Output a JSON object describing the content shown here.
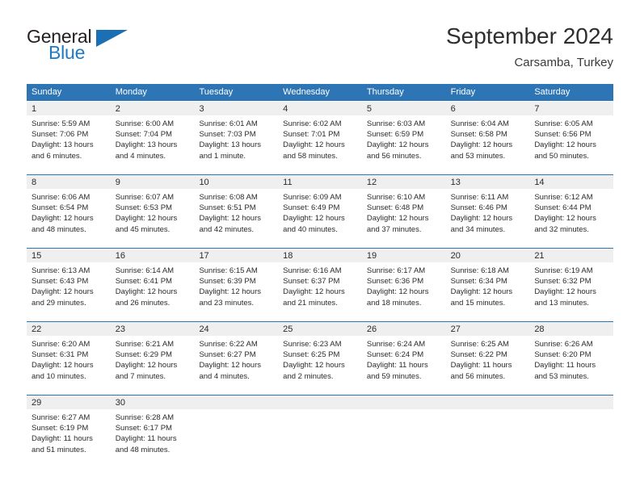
{
  "brand": {
    "name_part1": "General",
    "name_part2": "Blue",
    "flag_icon": "brand-triangle-icon"
  },
  "header": {
    "title": "September 2024",
    "subtitle": "Carsamba, Turkey"
  },
  "colors": {
    "header_blue": "#2e75b6",
    "brand_blue": "#1f7ac4",
    "day_band_gray": "#efefef",
    "text_dark": "#2b2b2b"
  },
  "weekdays": [
    "Sunday",
    "Monday",
    "Tuesday",
    "Wednesday",
    "Thursday",
    "Friday",
    "Saturday"
  ],
  "weeks": [
    {
      "separator": false,
      "days": [
        {
          "num": "1",
          "sunrise": "Sunrise: 5:59 AM",
          "sunset": "Sunset: 7:06 PM",
          "daylight_line1": "Daylight: 13 hours",
          "daylight_line2": "and 6 minutes."
        },
        {
          "num": "2",
          "sunrise": "Sunrise: 6:00 AM",
          "sunset": "Sunset: 7:04 PM",
          "daylight_line1": "Daylight: 13 hours",
          "daylight_line2": "and 4 minutes."
        },
        {
          "num": "3",
          "sunrise": "Sunrise: 6:01 AM",
          "sunset": "Sunset: 7:03 PM",
          "daylight_line1": "Daylight: 13 hours",
          "daylight_line2": "and 1 minute."
        },
        {
          "num": "4",
          "sunrise": "Sunrise: 6:02 AM",
          "sunset": "Sunset: 7:01 PM",
          "daylight_line1": "Daylight: 12 hours",
          "daylight_line2": "and 58 minutes."
        },
        {
          "num": "5",
          "sunrise": "Sunrise: 6:03 AM",
          "sunset": "Sunset: 6:59 PM",
          "daylight_line1": "Daylight: 12 hours",
          "daylight_line2": "and 56 minutes."
        },
        {
          "num": "6",
          "sunrise": "Sunrise: 6:04 AM",
          "sunset": "Sunset: 6:58 PM",
          "daylight_line1": "Daylight: 12 hours",
          "daylight_line2": "and 53 minutes."
        },
        {
          "num": "7",
          "sunrise": "Sunrise: 6:05 AM",
          "sunset": "Sunset: 6:56 PM",
          "daylight_line1": "Daylight: 12 hours",
          "daylight_line2": "and 50 minutes."
        }
      ]
    },
    {
      "separator": true,
      "days": [
        {
          "num": "8",
          "sunrise": "Sunrise: 6:06 AM",
          "sunset": "Sunset: 6:54 PM",
          "daylight_line1": "Daylight: 12 hours",
          "daylight_line2": "and 48 minutes."
        },
        {
          "num": "9",
          "sunrise": "Sunrise: 6:07 AM",
          "sunset": "Sunset: 6:53 PM",
          "daylight_line1": "Daylight: 12 hours",
          "daylight_line2": "and 45 minutes."
        },
        {
          "num": "10",
          "sunrise": "Sunrise: 6:08 AM",
          "sunset": "Sunset: 6:51 PM",
          "daylight_line1": "Daylight: 12 hours",
          "daylight_line2": "and 42 minutes."
        },
        {
          "num": "11",
          "sunrise": "Sunrise: 6:09 AM",
          "sunset": "Sunset: 6:49 PM",
          "daylight_line1": "Daylight: 12 hours",
          "daylight_line2": "and 40 minutes."
        },
        {
          "num": "12",
          "sunrise": "Sunrise: 6:10 AM",
          "sunset": "Sunset: 6:48 PM",
          "daylight_line1": "Daylight: 12 hours",
          "daylight_line2": "and 37 minutes."
        },
        {
          "num": "13",
          "sunrise": "Sunrise: 6:11 AM",
          "sunset": "Sunset: 6:46 PM",
          "daylight_line1": "Daylight: 12 hours",
          "daylight_line2": "and 34 minutes."
        },
        {
          "num": "14",
          "sunrise": "Sunrise: 6:12 AM",
          "sunset": "Sunset: 6:44 PM",
          "daylight_line1": "Daylight: 12 hours",
          "daylight_line2": "and 32 minutes."
        }
      ]
    },
    {
      "separator": true,
      "days": [
        {
          "num": "15",
          "sunrise": "Sunrise: 6:13 AM",
          "sunset": "Sunset: 6:43 PM",
          "daylight_line1": "Daylight: 12 hours",
          "daylight_line2": "and 29 minutes."
        },
        {
          "num": "16",
          "sunrise": "Sunrise: 6:14 AM",
          "sunset": "Sunset: 6:41 PM",
          "daylight_line1": "Daylight: 12 hours",
          "daylight_line2": "and 26 minutes."
        },
        {
          "num": "17",
          "sunrise": "Sunrise: 6:15 AM",
          "sunset": "Sunset: 6:39 PM",
          "daylight_line1": "Daylight: 12 hours",
          "daylight_line2": "and 23 minutes."
        },
        {
          "num": "18",
          "sunrise": "Sunrise: 6:16 AM",
          "sunset": "Sunset: 6:37 PM",
          "daylight_line1": "Daylight: 12 hours",
          "daylight_line2": "and 21 minutes."
        },
        {
          "num": "19",
          "sunrise": "Sunrise: 6:17 AM",
          "sunset": "Sunset: 6:36 PM",
          "daylight_line1": "Daylight: 12 hours",
          "daylight_line2": "and 18 minutes."
        },
        {
          "num": "20",
          "sunrise": "Sunrise: 6:18 AM",
          "sunset": "Sunset: 6:34 PM",
          "daylight_line1": "Daylight: 12 hours",
          "daylight_line2": "and 15 minutes."
        },
        {
          "num": "21",
          "sunrise": "Sunrise: 6:19 AM",
          "sunset": "Sunset: 6:32 PM",
          "daylight_line1": "Daylight: 12 hours",
          "daylight_line2": "and 13 minutes."
        }
      ]
    },
    {
      "separator": true,
      "days": [
        {
          "num": "22",
          "sunrise": "Sunrise: 6:20 AM",
          "sunset": "Sunset: 6:31 PM",
          "daylight_line1": "Daylight: 12 hours",
          "daylight_line2": "and 10 minutes."
        },
        {
          "num": "23",
          "sunrise": "Sunrise: 6:21 AM",
          "sunset": "Sunset: 6:29 PM",
          "daylight_line1": "Daylight: 12 hours",
          "daylight_line2": "and 7 minutes."
        },
        {
          "num": "24",
          "sunrise": "Sunrise: 6:22 AM",
          "sunset": "Sunset: 6:27 PM",
          "daylight_line1": "Daylight: 12 hours",
          "daylight_line2": "and 4 minutes."
        },
        {
          "num": "25",
          "sunrise": "Sunrise: 6:23 AM",
          "sunset": "Sunset: 6:25 PM",
          "daylight_line1": "Daylight: 12 hours",
          "daylight_line2": "and 2 minutes."
        },
        {
          "num": "26",
          "sunrise": "Sunrise: 6:24 AM",
          "sunset": "Sunset: 6:24 PM",
          "daylight_line1": "Daylight: 11 hours",
          "daylight_line2": "and 59 minutes."
        },
        {
          "num": "27",
          "sunrise": "Sunrise: 6:25 AM",
          "sunset": "Sunset: 6:22 PM",
          "daylight_line1": "Daylight: 11 hours",
          "daylight_line2": "and 56 minutes."
        },
        {
          "num": "28",
          "sunrise": "Sunrise: 6:26 AM",
          "sunset": "Sunset: 6:20 PM",
          "daylight_line1": "Daylight: 11 hours",
          "daylight_line2": "and 53 minutes."
        }
      ]
    },
    {
      "separator": true,
      "days": [
        {
          "num": "29",
          "sunrise": "Sunrise: 6:27 AM",
          "sunset": "Sunset: 6:19 PM",
          "daylight_line1": "Daylight: 11 hours",
          "daylight_line2": "and 51 minutes."
        },
        {
          "num": "30",
          "sunrise": "Sunrise: 6:28 AM",
          "sunset": "Sunset: 6:17 PM",
          "daylight_line1": "Daylight: 11 hours",
          "daylight_line2": "and 48 minutes."
        },
        {
          "num": "",
          "sunrise": "",
          "sunset": "",
          "daylight_line1": "",
          "daylight_line2": ""
        },
        {
          "num": "",
          "sunrise": "",
          "sunset": "",
          "daylight_line1": "",
          "daylight_line2": ""
        },
        {
          "num": "",
          "sunrise": "",
          "sunset": "",
          "daylight_line1": "",
          "daylight_line2": ""
        },
        {
          "num": "",
          "sunrise": "",
          "sunset": "",
          "daylight_line1": "",
          "daylight_line2": ""
        },
        {
          "num": "",
          "sunrise": "",
          "sunset": "",
          "daylight_line1": "",
          "daylight_line2": ""
        }
      ]
    }
  ]
}
